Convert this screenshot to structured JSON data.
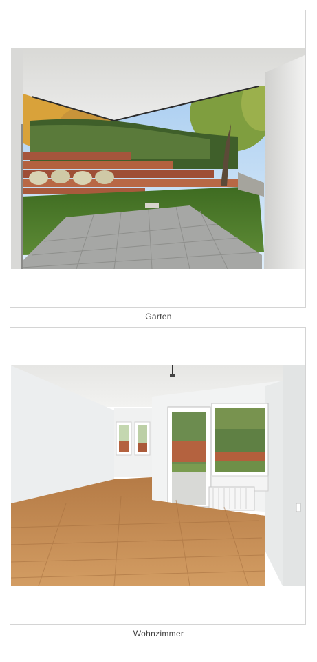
{
  "gallery": {
    "items": [
      {
        "caption": "Garten"
      },
      {
        "caption": "Wohnzimmer"
      }
    ]
  },
  "colors": {
    "frame_border": "#d4d4d4",
    "caption_text": "#444444",
    "wall": "#eceff0",
    "floor": "#c8925a",
    "lawn": "#4f7a2c",
    "patio": "#a9aaa8"
  }
}
